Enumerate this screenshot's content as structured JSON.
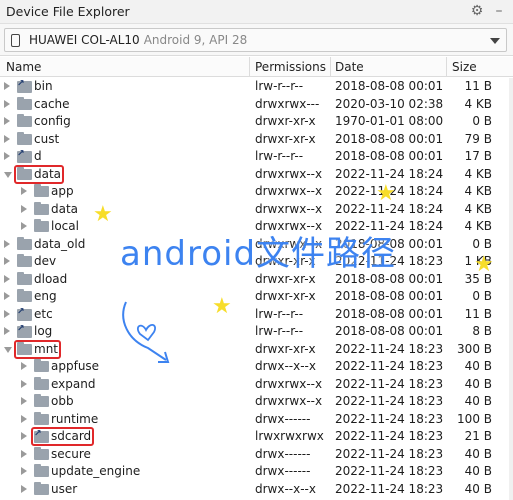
{
  "window": {
    "title": "Device File Explorer",
    "icons": [
      "gear-icon",
      "minimize-icon"
    ]
  },
  "device": {
    "name": "HUAWEI COL-AL10",
    "detail": "Android 9, API 28"
  },
  "columns": {
    "name": "Name",
    "permissions": "Permissions",
    "date": "Date",
    "size": "Size"
  },
  "rows": [
    {
      "name": "bin",
      "type": "link",
      "level": 0,
      "expanded": false,
      "perm": "lrw-r--r--",
      "date": "2018-08-08 00:01",
      "size": "11 B"
    },
    {
      "name": "cache",
      "type": "folder",
      "level": 0,
      "expanded": false,
      "perm": "drwxrwx---",
      "date": "2020-03-10 02:38",
      "size": "4 KB"
    },
    {
      "name": "config",
      "type": "folder",
      "level": 0,
      "expanded": false,
      "perm": "drwxr-xr-x",
      "date": "1970-01-01 08:00",
      "size": "0 B"
    },
    {
      "name": "cust",
      "type": "folder",
      "level": 0,
      "expanded": false,
      "perm": "drwxr-xr-x",
      "date": "2018-08-08 00:01",
      "size": "79 B"
    },
    {
      "name": "d",
      "type": "link",
      "level": 0,
      "expanded": false,
      "perm": "lrw-r--r--",
      "date": "2018-08-08 00:01",
      "size": "17 B"
    },
    {
      "name": "data",
      "type": "folder",
      "level": 0,
      "expanded": true,
      "perm": "drwxrwx--x",
      "date": "2022-11-24 18:24",
      "size": "4 KB"
    },
    {
      "name": "app",
      "type": "folder",
      "level": 1,
      "expanded": false,
      "perm": "drwxrwx--x",
      "date": "2022-11-24 18:24",
      "size": "4 KB"
    },
    {
      "name": "data",
      "type": "folder",
      "level": 1,
      "expanded": false,
      "perm": "drwxrwx--x",
      "date": "2022-11-24 18:24",
      "size": "4 KB"
    },
    {
      "name": "local",
      "type": "folder",
      "level": 1,
      "expanded": false,
      "perm": "drwxrwx--x",
      "date": "2022-11-24 18:24",
      "size": "4 KB"
    },
    {
      "name": "data_old",
      "type": "folder",
      "level": 0,
      "expanded": false,
      "perm": "drwxrwx--x",
      "date": "2018-08-08 00:01",
      "size": "0 B"
    },
    {
      "name": "dev",
      "type": "folder",
      "level": 0,
      "expanded": false,
      "perm": "drwxr-xr-x",
      "date": "2022-11-24 18:23",
      "size": "1 KB"
    },
    {
      "name": "dload",
      "type": "folder",
      "level": 0,
      "expanded": false,
      "perm": "drwxr-xr-x",
      "date": "2018-08-08 00:01",
      "size": "35 B"
    },
    {
      "name": "eng",
      "type": "folder",
      "level": 0,
      "expanded": false,
      "perm": "drwxr-xr-x",
      "date": "2018-08-08 00:01",
      "size": "0 B"
    },
    {
      "name": "etc",
      "type": "link",
      "level": 0,
      "expanded": false,
      "perm": "lrw-r--r--",
      "date": "2018-08-08 00:01",
      "size": "11 B"
    },
    {
      "name": "log",
      "type": "link",
      "level": 0,
      "expanded": false,
      "perm": "lrw-r--r--",
      "date": "2018-08-08 00:01",
      "size": "8 B"
    },
    {
      "name": "mnt",
      "type": "folder",
      "level": 0,
      "expanded": true,
      "perm": "drwxr-xr-x",
      "date": "2022-11-24 18:23",
      "size": "300 B"
    },
    {
      "name": "appfuse",
      "type": "folder",
      "level": 1,
      "expanded": false,
      "perm": "drwx--x--x",
      "date": "2022-11-24 18:23",
      "size": "40 B"
    },
    {
      "name": "expand",
      "type": "folder",
      "level": 1,
      "expanded": false,
      "perm": "drwxrwx--x",
      "date": "2022-11-24 18:23",
      "size": "40 B"
    },
    {
      "name": "obb",
      "type": "folder",
      "level": 1,
      "expanded": false,
      "perm": "drwxrwx--x",
      "date": "2022-11-24 18:23",
      "size": "40 B"
    },
    {
      "name": "runtime",
      "type": "folder",
      "level": 1,
      "expanded": false,
      "perm": "drwx------",
      "date": "2022-11-24 18:23",
      "size": "100 B"
    },
    {
      "name": "sdcard",
      "type": "link",
      "level": 1,
      "expanded": false,
      "perm": "lrwxrwxrwx",
      "date": "2022-11-24 18:23",
      "size": "21 B"
    },
    {
      "name": "secure",
      "type": "folder",
      "level": 1,
      "expanded": false,
      "perm": "drwx------",
      "date": "2022-11-24 18:23",
      "size": "40 B"
    },
    {
      "name": "update_engine",
      "type": "folder",
      "level": 1,
      "expanded": false,
      "perm": "drwx------",
      "date": "2022-11-24 18:23",
      "size": "40 B"
    },
    {
      "name": "user",
      "type": "folder",
      "level": 1,
      "expanded": false,
      "perm": "drwx--x--x",
      "date": "2022-11-24 18:23",
      "size": "40 B"
    }
  ],
  "highlighted": [
    "data",
    "mnt",
    "sdcard"
  ],
  "overlay": {
    "text": "android文件路径",
    "color": "#3d83f0",
    "star_color": "#f7dd2a"
  }
}
